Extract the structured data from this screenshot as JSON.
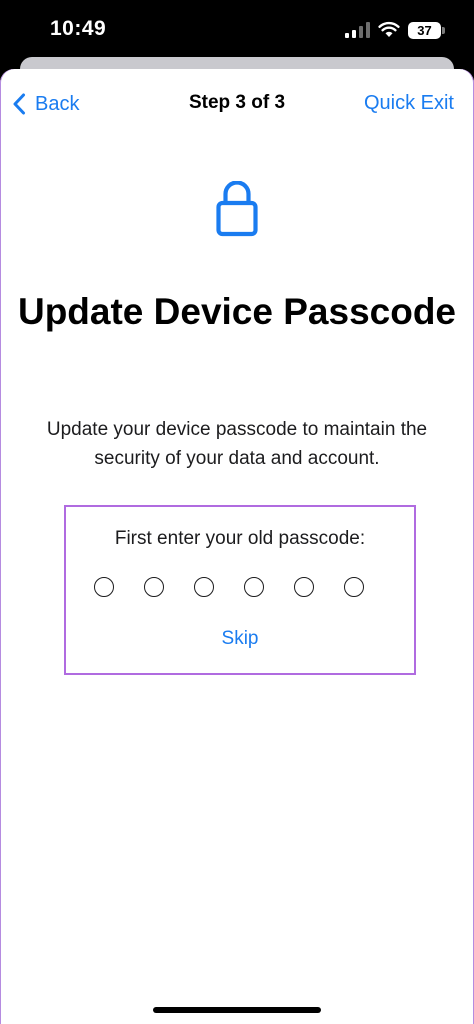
{
  "status_bar": {
    "time": "10:49",
    "battery_level": "37",
    "icons": [
      "signal-icon",
      "wifi-icon",
      "battery-icon"
    ]
  },
  "nav": {
    "back_label": "Back",
    "title": "Step 3 of 3",
    "quick_exit_label": "Quick Exit"
  },
  "main": {
    "icon": "lock-icon",
    "heading": "Update Device Passcode",
    "description": "Update your device passcode to maintain the security of your data and account."
  },
  "passcode": {
    "prompt": "First enter your old passcode:",
    "digit_count": 6,
    "skip_label": "Skip"
  },
  "colors": {
    "accent": "#1a7cf0",
    "highlight_border": "#b06be0"
  }
}
